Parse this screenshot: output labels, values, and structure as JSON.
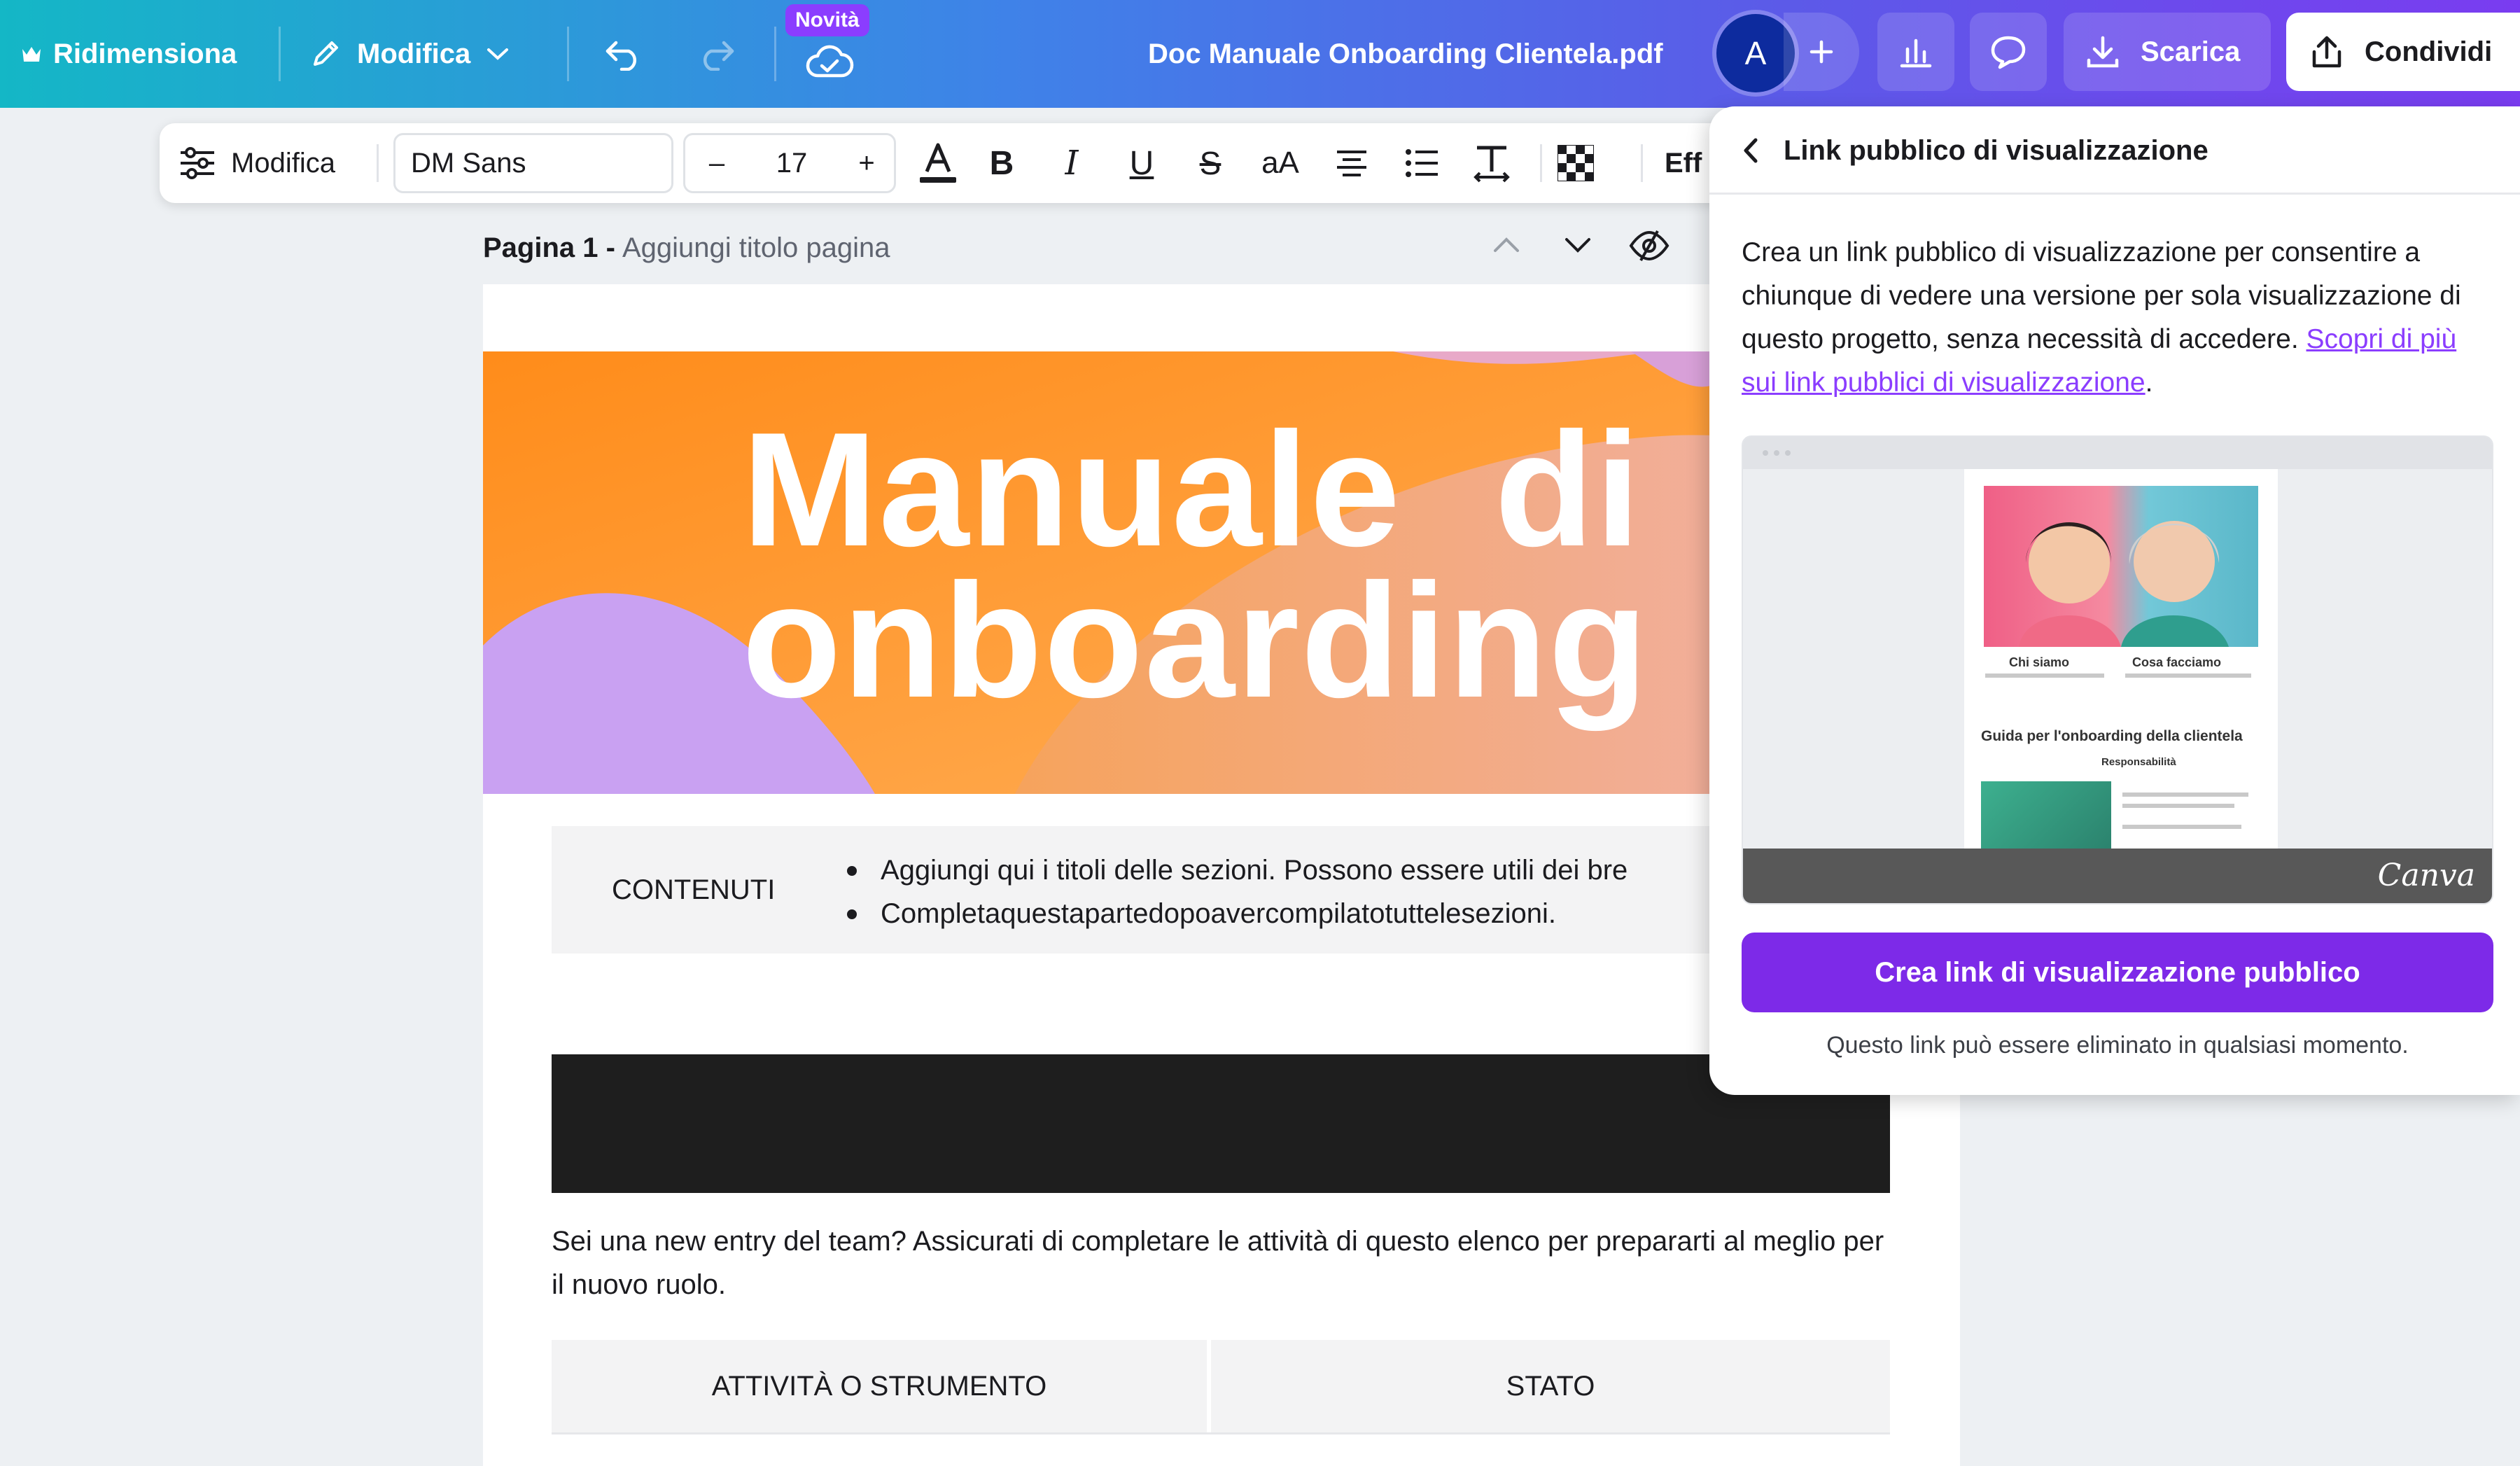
{
  "topbar": {
    "resize_label": "Ridimensiona",
    "edit_label": "Modifica",
    "new_badge": "Novità",
    "filename": "Doc Manuale Onboarding Clientela.pdf",
    "avatar_initial": "A",
    "download_label": "Scarica",
    "share_label": "Condividi"
  },
  "format_toolbar": {
    "edit_label": "Modifica",
    "font_name": "DM Sans",
    "font_size": "17",
    "minus": "–",
    "plus": "+",
    "case_label": "aA",
    "effects_label": "Eff"
  },
  "page": {
    "label": "Pagina 1 -",
    "title_placeholder": "Aggiungi titolo pagina"
  },
  "document": {
    "hero_title": "Manuale  di\nonboarding",
    "toc_label": "CONTENUTI",
    "toc_items": [
      "Aggiungi qui i titoli delle sezioni. Possono essere utili dei bre",
      "Completaquestapartedopoavercompilatotuttelesezioni."
    ],
    "intro_text": "Sei una new entry del team? Assicurati di completare le attività di questo elenco per prepararti al meglio per il nuovo ruolo.",
    "table_headers": [
      "ATTIVITÀ O STRUMENTO",
      "STATO"
    ]
  },
  "share_panel": {
    "title": "Link pubblico di visualizzazione",
    "description": "Crea un link pubblico di visualizzazione per consentire a chiunque di vedere una versione per sola visualizzazione di questo progetto, senza necessità di accedere.",
    "learn_more": "Scopri di più sui link pubblici di visualizzazione",
    "period": ".",
    "preview_caption_1": "Chi siamo",
    "preview_caption_2": "Cosa facciamo",
    "preview_heading": "Guida per l'onboarding della clientela",
    "preview_sub": "Responsabilità",
    "preview_brand": "Canva",
    "cta_label": "Crea link di visualizzazione pubblico",
    "note": "Questo link può essere eliminato in qualsiasi momento."
  },
  "colors": {
    "accent": "#7d2ae8",
    "badge": "#8b3dff",
    "hero_orange": "#ff9a2e"
  }
}
